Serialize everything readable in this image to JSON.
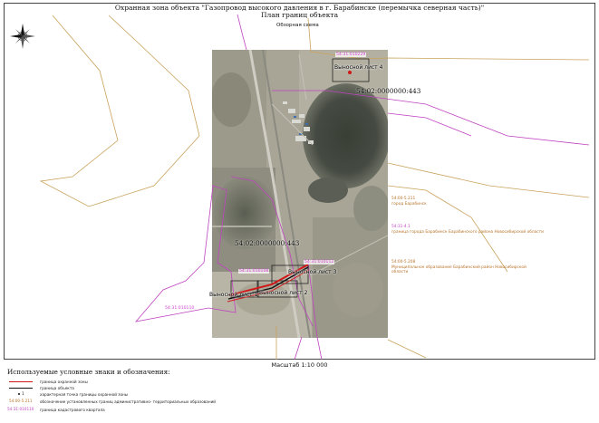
{
  "title": {
    "line1": "Охранная зона объекта \"Газопровод высокого давления в г. Барабинске (перемычка северная часть)\"",
    "line2": "План границ объекта"
  },
  "overview_label": "Обзорная схема",
  "scale_label": "Масштаб 1:10 000",
  "map_labels": {
    "sheet_4": "Выносной лист 4",
    "sheet_3": "Выносной лист 3",
    "sheet_2": "Выносной лист 2",
    "sheet_1": "Выносной лист 1",
    "parcel_top": "54:02:0000000:443",
    "parcel_mid": "54:02:0000000:443",
    "cad_top": "54:31:010229",
    "cad_108": "54:31:010108",
    "cad_112": "54:31:010112",
    "cad_110": "54:31:010110"
  },
  "annotations": [
    {
      "code": "54:00-5.211",
      "text": "город Барабинск",
      "color": "orange"
    },
    {
      "code": "54:31-4.1",
      "text": "граница города Барабинск Барабинского района Новосибирской области",
      "color": "cad"
    },
    {
      "code": "54:00-5.208",
      "text": "Муниципальное образование Барабинский район Новосибирской области",
      "color": "orange"
    }
  ],
  "legend": {
    "title": "Используемые условные знаки и обозначения:",
    "items": [
      {
        "symbol": "red-line",
        "text": "граница охранной зоны"
      },
      {
        "symbol": "black-line",
        "text": "граница объекта"
      },
      {
        "symbol": "point",
        "symbol_label": "1",
        "text": "характерная точка границы охранной зоны"
      },
      {
        "symbol": "orange-code",
        "symbol_label": "54:00-5.211",
        "text": "обозначение установленных границ административно- территориальных образований"
      },
      {
        "symbol": "magenta-code",
        "symbol_label": "54:31:010110",
        "text": "граница кадастрового квартала"
      }
    ]
  },
  "colors": {
    "protection_zone": "#d01818",
    "object_boundary": "#111111",
    "admin_boundary": "#c9a25b",
    "cadastral_boundary": "#c043c0"
  },
  "icons": {
    "north_arrow": "compass-rose-icon"
  }
}
